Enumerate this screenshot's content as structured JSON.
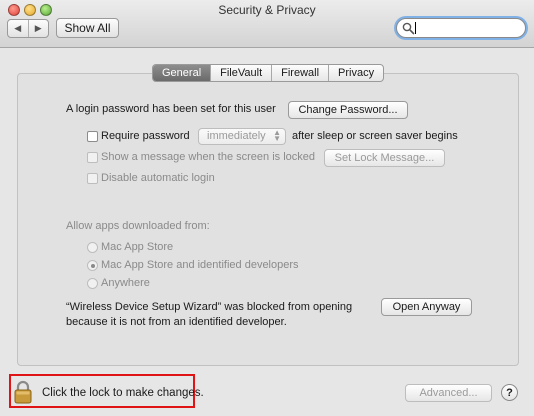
{
  "window": {
    "title": "Security & Privacy"
  },
  "toolbar": {
    "back_glyph": "◀",
    "forward_glyph": "▶",
    "show_all_label": "Show All",
    "search_value": ""
  },
  "tabs": [
    {
      "label": "General",
      "active": true
    },
    {
      "label": "FileVault",
      "active": false
    },
    {
      "label": "Firewall",
      "active": false
    },
    {
      "label": "Privacy",
      "active": false
    }
  ],
  "general": {
    "login_password_text": "A login password has been set for this user",
    "change_password_label": "Change Password...",
    "require_password_label": "Require password",
    "require_password_checked": false,
    "require_password_delay": "immediately",
    "after_sleep_text": "after sleep or screen saver begins",
    "show_message_label": "Show a message when the screen is locked",
    "set_lock_message_label": "Set Lock Message...",
    "disable_auto_login_label": "Disable automatic login",
    "allow_apps_label": "Allow apps downloaded from:",
    "allow_options": [
      {
        "label": "Mac App Store",
        "selected": false
      },
      {
        "label": "Mac App Store and identified developers",
        "selected": true
      },
      {
        "label": "Anywhere",
        "selected": false
      }
    ],
    "blocked_line1": "“Wireless Device Setup Wizard” was blocked from opening",
    "blocked_line2": "because it is not from an identified developer.",
    "open_anyway_label": "Open Anyway"
  },
  "footer": {
    "lock_text": "Click the lock to make changes.",
    "advanced_label": "Advanced...",
    "help_label": "?"
  },
  "colors": {
    "highlight_box": "#e01414",
    "search_focus_ring": "#7fb0e6",
    "active_tab": "#6b6b6b"
  }
}
